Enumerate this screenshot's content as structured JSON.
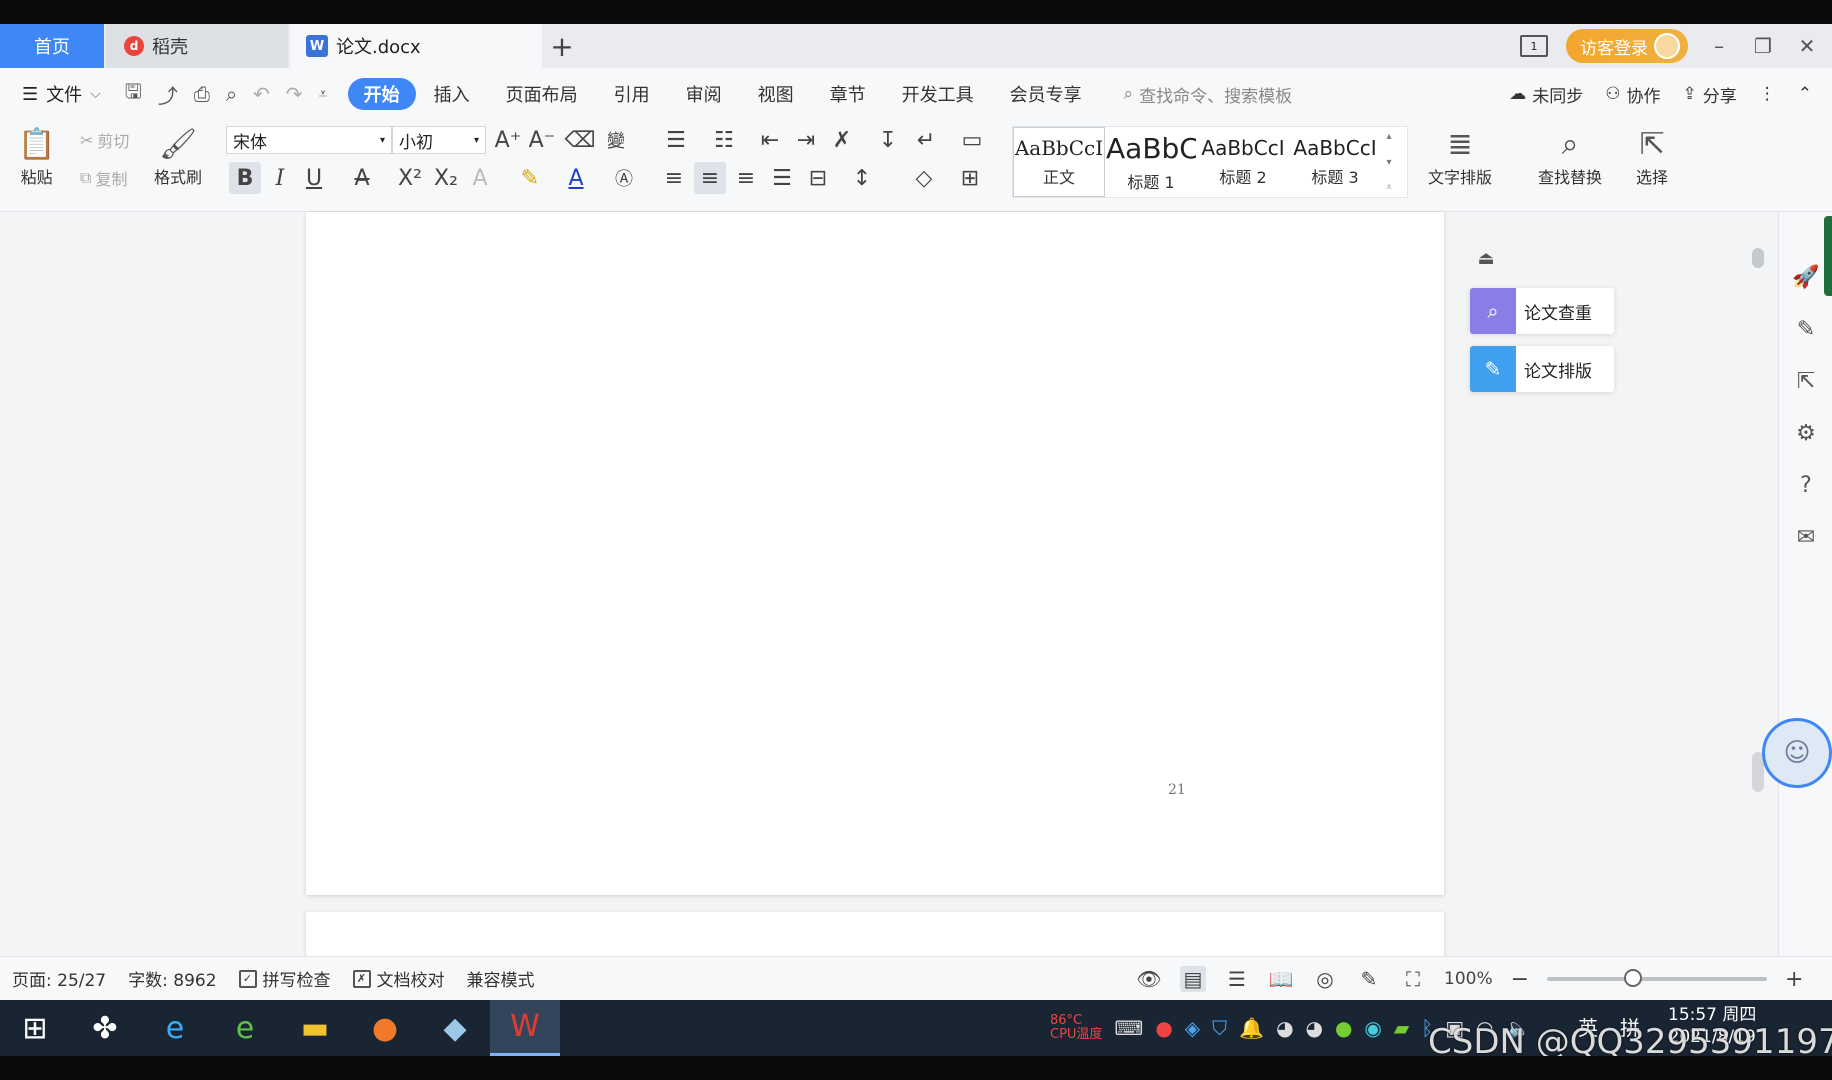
{
  "tabs": {
    "home": "首页",
    "daoke": "稻壳",
    "doc": "论文.docx",
    "add": "+"
  },
  "window": {
    "reader_label": "1",
    "guest_login": "访客登录",
    "minimize": "–",
    "restore": "❐",
    "close": "✕"
  },
  "menu": {
    "hamburger": "☰",
    "file": "文件",
    "file_caret": "⌵",
    "tabs": [
      "开始",
      "插入",
      "页面布局",
      "引用",
      "审阅",
      "视图",
      "章节",
      "开发工具",
      "会员专享"
    ],
    "search_placeholder": "查找命令、搜索模板",
    "sync": "未同步",
    "collab": "协作",
    "share": "分享",
    "more": "⋮",
    "collapse": "⌃"
  },
  "ribbon": {
    "paste": "粘贴",
    "cut": "剪切",
    "copy": "复制",
    "format_painter": "格式刷",
    "font_name": "宋体",
    "font_size": "小初",
    "styles": [
      {
        "preview": "AaBbCcI",
        "name": "正文"
      },
      {
        "preview": "AaBbC",
        "name": "标题 1"
      },
      {
        "preview": "AaBbCcI",
        "name": "标题 2"
      },
      {
        "preview": "AaBbCcI",
        "name": "标题 3"
      }
    ],
    "text_layout": "文字排版",
    "find_replace": "查找替换",
    "select": "选择"
  },
  "document": {
    "page_number": "21"
  },
  "side_panel": {
    "plagiarism": "论文查重",
    "formatting": "论文排版"
  },
  "status": {
    "page": "页面: 25/27",
    "words": "字数: 8962",
    "spell_check": "拼写检查",
    "doc_review": "文档校对",
    "compat": "兼容模式",
    "zoom": "100%",
    "zoom_minus": "−",
    "zoom_plus": "+",
    "zoom_fraction": 0.38
  },
  "taskbar": {
    "cpu_temp": "86°C",
    "cpu_label": "CPU温度",
    "ime_lang": "英",
    "ime_mode": "拼",
    "time": "15:57 周四",
    "date": "2021/8/19"
  },
  "watermark": "CSDN @QQ3295391197",
  "colors": {
    "accent": "#3f87f5",
    "guest": "#f3a62d",
    "taskbar": "#1a2533"
  }
}
